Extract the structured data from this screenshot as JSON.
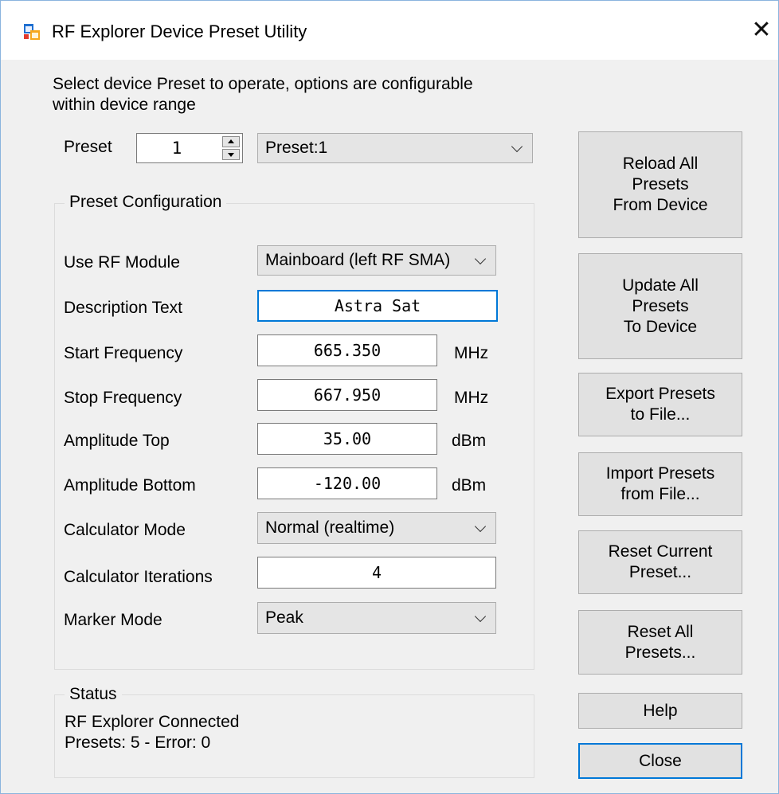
{
  "window": {
    "title": "RF Explorer Device Preset Utility",
    "close_glyph": "✕"
  },
  "intro": {
    "line1": "Select device Preset to operate, options are configurable",
    "line2": "within device range"
  },
  "preset": {
    "label": "Preset",
    "number": "1",
    "selected": "Preset:1"
  },
  "config": {
    "group_title": "Preset Configuration",
    "rf_module": {
      "label": "Use RF Module",
      "value": "Mainboard (left RF SMA)"
    },
    "description": {
      "label": "Description Text",
      "value": "Astra Sat"
    },
    "start_freq": {
      "label": "Start Frequency",
      "value": "665.350",
      "unit": "MHz"
    },
    "stop_freq": {
      "label": "Stop Frequency",
      "value": "667.950",
      "unit": "MHz"
    },
    "amp_top": {
      "label": "Amplitude Top",
      "value": "35.00",
      "unit": "dBm"
    },
    "amp_bottom": {
      "label": "Amplitude Bottom",
      "value": "-120.00",
      "unit": "dBm"
    },
    "calc_mode": {
      "label": "Calculator Mode",
      "value": "Normal (realtime)"
    },
    "calc_iter": {
      "label": "Calculator Iterations",
      "value": "4"
    },
    "marker_mode": {
      "label": "Marker Mode",
      "value": "Peak"
    }
  },
  "status": {
    "group_title": "Status",
    "line1": "RF Explorer Connected",
    "line2": "Presets: 5 - Error: 0"
  },
  "buttons": {
    "reload": [
      "Reload All",
      "Presets",
      "From Device"
    ],
    "update": [
      "Update All",
      "Presets",
      "To Device"
    ],
    "export": [
      "Export Presets",
      "to File..."
    ],
    "import": [
      "Import Presets",
      "from File..."
    ],
    "reset_current": [
      "Reset Current",
      "Preset..."
    ],
    "reset_all": [
      "Reset All",
      "Presets..."
    ],
    "help": "Help",
    "close": "Close"
  },
  "colors": {
    "accent": "#0078d7",
    "window_bg": "#f0f0f0",
    "button_bg": "#e1e1e1"
  },
  "icons": {
    "app": "app-window-icon",
    "close": "close-icon"
  }
}
